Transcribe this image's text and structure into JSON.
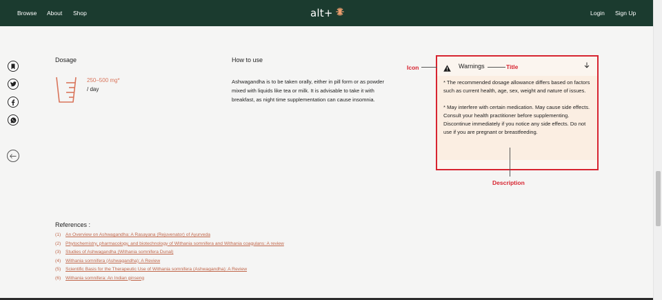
{
  "header": {
    "nav_left": [
      "Browse",
      "About",
      "Shop"
    ],
    "logo_text": "alt+",
    "nav_right": [
      "Login",
      "Sign Up"
    ]
  },
  "sidebar": {
    "icons": [
      "bookmark-icon",
      "twitter-icon",
      "facebook-icon",
      "whatsapp-icon"
    ],
    "back_icon": "back-arrow-icon"
  },
  "dosage": {
    "heading": "Dosage",
    "range": "250–500 mg*",
    "unit": "/ day",
    "icon": "measuring-cup-icon"
  },
  "howto": {
    "heading": "How to use",
    "text": "Ashwagandha is to be taken orally, either in pill form or as powder mixed with liquids like tea or milk. It is advisable to take it with breakfast, as night time supplementation can cause insomnia."
  },
  "warnings": {
    "title": "Warnings",
    "icon": "warning-icon",
    "paragraphs": [
      "* The recommended dosage allowance differs based on factors such as current health, age, sex, weight and nature of issues.",
      "* May interfere with certain medication. May cause side effects. Consult your health practitioner before supplementing.  Discontinue immediately if you notice any side effects. Do not use if you are pregnant or breastfeeding."
    ]
  },
  "annotations": {
    "icon": "Icon",
    "title": "Title",
    "description": "Description"
  },
  "references": {
    "heading": "References :",
    "items": [
      {
        "num": "(1)",
        "text": "An Overview on Ashwagandha: A Rasayana (Rejuvenator) of Ayurveda"
      },
      {
        "num": "(2)",
        "text": "Phytochemistry, pharmacology, and biotechnology of Withania somnifera and Withania coagulans: A review"
      },
      {
        "num": "(3)",
        "text": "Studies of Ashwagandha (Withania somnifera Dunal)"
      },
      {
        "num": "(4)",
        "text": "Withania somnifera (Ashwagandha): A Review"
      },
      {
        "num": "(5)",
        "text": "Scientific Basis for the Therapeutic Use of Withania somnifera (Ashwagandha): A Review"
      },
      {
        "num": "(6)",
        "text": "Withania somnifera: An Indian ginseng"
      }
    ]
  },
  "colors": {
    "header_bg": "#1b3b2f",
    "accent": "#d9745a",
    "annotation_red": "#d7232f",
    "warning_bg": "#fbeee2"
  }
}
